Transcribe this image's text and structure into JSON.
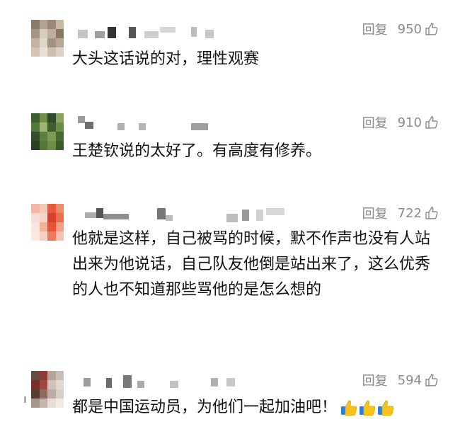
{
  "comments": [
    {
      "reply_label": "回复",
      "like_count": "950",
      "text": "大头这话说的对，理性观赛",
      "avatar_colors": [
        "#8c7a6a",
        "#b3a392",
        "#9c8878",
        "#c9b9a6",
        "#a69584",
        "#d7ccbd",
        "#bfae9c",
        "#8a7866",
        "#c2b3a3",
        "#e0d6c8",
        "#a39180",
        "#b8a795",
        "#d2c5b6",
        "#e8e0d4",
        "#cdbfaf",
        "#ddd2c4"
      ]
    },
    {
      "reply_label": "回复",
      "like_count": "910",
      "text": "王楚钦说的太好了。有高度有修养。",
      "avatar_colors": [
        "#3f5e2e",
        "#6f8f4a",
        "#2f4a27",
        "#8aa35f",
        "#527a38",
        "#9cb774",
        "#405f30",
        "#6b8c44",
        "#344e29",
        "#5d7f3c",
        "#7d9c56",
        "#486b33",
        "#2a4222",
        "#56773a",
        "#6d8e47",
        "#3a5a2b"
      ]
    },
    {
      "reply_label": "回复",
      "like_count": "722",
      "text": "他就是这样，自己被骂的时候，默不作声也没有人站出来为他说话，自己队友他倒是站出来了，这么优秀的人也不知道那些骂他的是怎么想的",
      "avatar_colors": [
        "#f4b6a6",
        "#f7c8b8",
        "#e85a3a",
        "#f08a6a",
        "#f2e0d8",
        "#f8d2c4",
        "#d9432a",
        "#ec6e4e",
        "#fbe7df",
        "#f5b19c",
        "#e65437",
        "#f0a088",
        "#fde9e2",
        "#f7cfc1",
        "#e97a5e",
        "#f3c1b2"
      ]
    },
    {
      "reply_label": "回复",
      "like_count": "594",
      "text": "都是中国运动员，为他们一起加油吧！",
      "emoji_count": 3,
      "avatar_colors": [
        "#6a4a42",
        "#8b3a34",
        "#b4a49a",
        "#c9bdb5",
        "#7a2e2a",
        "#9c4a40",
        "#cfc3bb",
        "#e0d8d2",
        "#5a3a34",
        "#8f6a60",
        "#bcaea4",
        "#d8cec6",
        "#a8948a",
        "#c4b6ac",
        "#e4dcd6",
        "#f0ebe7"
      ]
    }
  ]
}
